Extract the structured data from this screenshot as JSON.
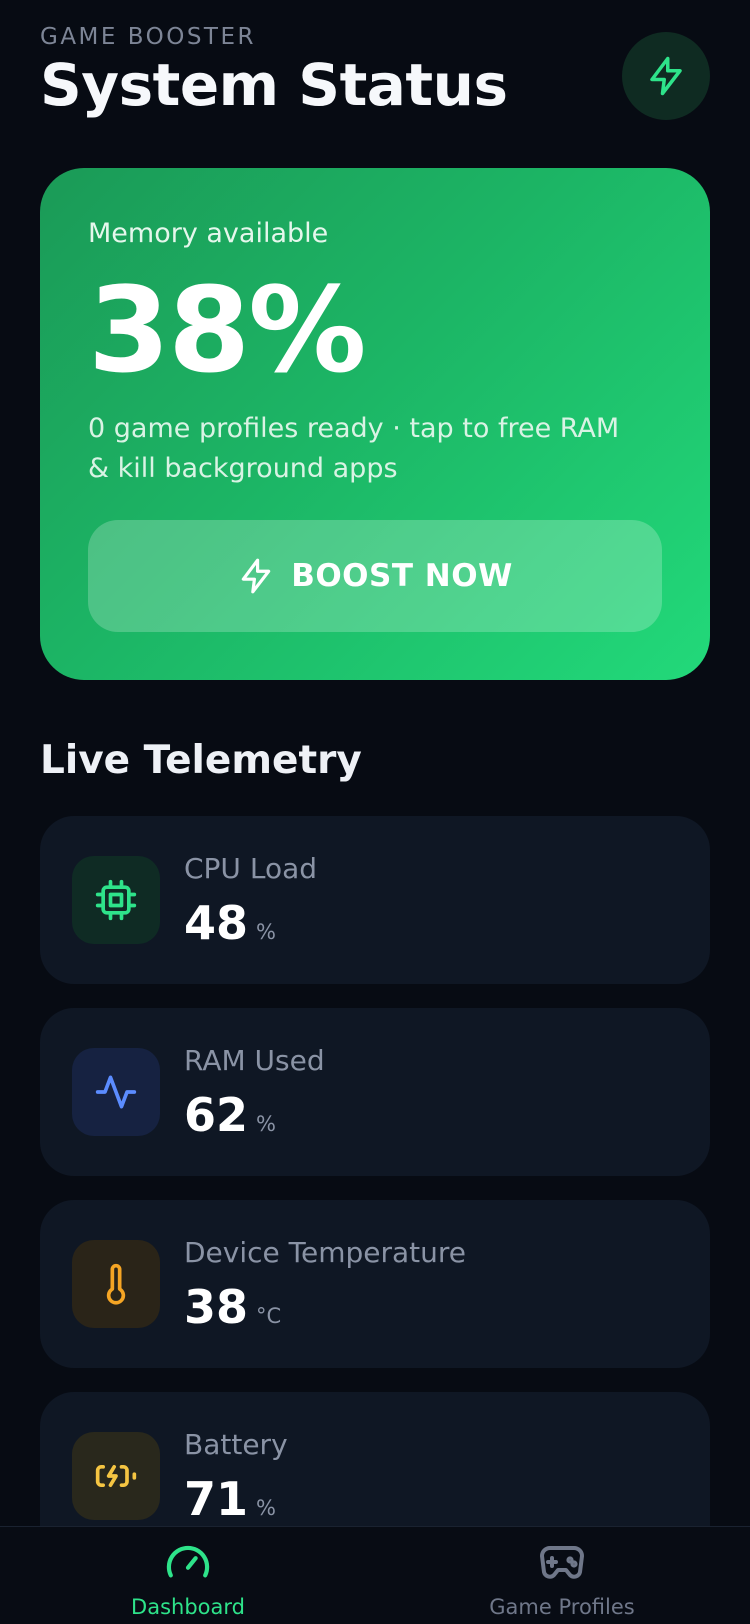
{
  "header": {
    "eyebrow": "GAME BOOSTER",
    "title": "System Status",
    "action_icon": "bolt-icon"
  },
  "hero": {
    "label": "Memory available",
    "value": "38%",
    "subtitle": "0 game profiles ready · tap to free RAM & kill background apps",
    "button_label": "BOOST NOW",
    "button_icon": "bolt-icon"
  },
  "telemetry": {
    "title": "Live Telemetry",
    "items": [
      {
        "label": "CPU Load",
        "value": "48",
        "unit": "%",
        "icon": "cpu-icon",
        "color": "#2ee38a"
      },
      {
        "label": "RAM Used",
        "value": "62",
        "unit": "%",
        "icon": "activity-icon",
        "color": "#5b8cff"
      },
      {
        "label": "Device Temperature",
        "value": "38",
        "unit": "°C",
        "icon": "thermometer-icon",
        "color": "#f5a524"
      },
      {
        "label": "Battery",
        "value": "71",
        "unit": "%",
        "icon": "battery-charging-icon",
        "color": "#f5c542"
      }
    ]
  },
  "nav": {
    "items": [
      {
        "label": "Dashboard",
        "icon": "gauge-icon",
        "active": true
      },
      {
        "label": "Game Profiles",
        "icon": "gamepad-icon",
        "active": false
      }
    ]
  },
  "colors": {
    "background": "#070b13",
    "card": "#0f1724",
    "accent": "#2ee38a"
  }
}
